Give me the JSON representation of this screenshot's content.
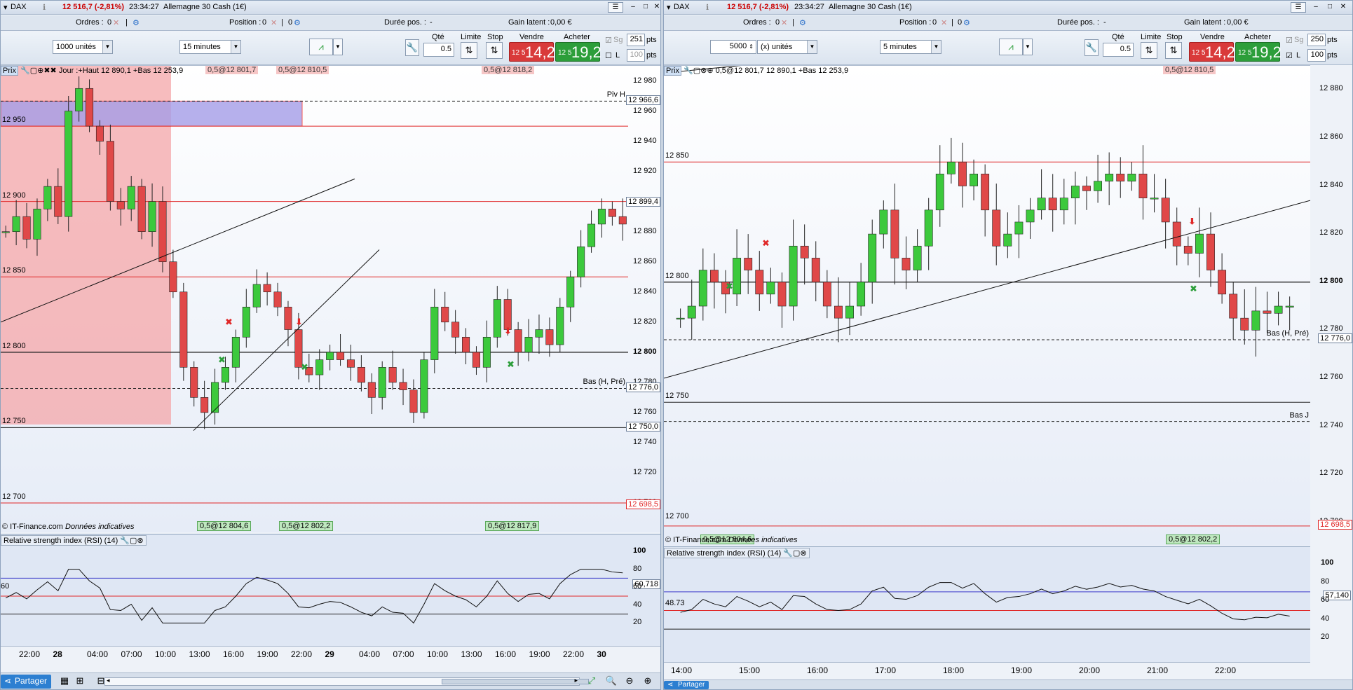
{
  "panels": [
    {
      "titlebar": {
        "instrument": "DAX",
        "price": "12 516,7 (-2,81%)",
        "time": "23:34:27",
        "name": "Allemagne 30 Cash (1€)"
      },
      "status": {
        "ordres_label": "Ordres :",
        "ordres_value": "0",
        "position_label": "Position :",
        "position_value": "0",
        "duree_label": "Durée pos. :",
        "duree_value": "-",
        "gain_label": "Gain latent :",
        "gain_value": "0,00 €"
      },
      "toolbar": {
        "units_value": "1000 unités",
        "timeframe_value": "15 minutes",
        "qte_label": "Qté",
        "qte_value": "0.5",
        "limite_label": "Limite",
        "stop_label": "Stop",
        "vendre_label": "Vendre",
        "acheter_label": "Acheter",
        "sell_small": "12 5",
        "sell_big": "14,2",
        "buy_small": "12 5",
        "buy_big": "19,2",
        "sg_label": "Sg",
        "sg_value": "251",
        "l_label": "L",
        "l_value": "100",
        "pts_label": "pts"
      },
      "legend": {
        "prix_label": "Prix",
        "text": "Jour :+Haut 12 890,1 +Bas 12 253,9"
      },
      "top_tags": [
        "0,5@12 801,7",
        "0,5@12 810,5",
        "0,5@12 818,2"
      ],
      "bottom_tags": [
        "0,5@12 804,6",
        "0,5@12 802,2",
        "0,5@12 817,9"
      ],
      "copyright": "© IT-Finance.com",
      "copyright_note": "Données indicatives",
      "price_axis": [
        "12 980",
        "12 960",
        "12 940",
        "12 920",
        "12 900",
        "12 880",
        "12 860",
        "12 840",
        "12 820",
        "12 800",
        "12 780",
        "12 760",
        "12 740",
        "12 720",
        "12 700"
      ],
      "axis_boxes": {
        "piv_h": "12 966,6",
        "cur": "12 899,4",
        "bas": "12 776,0",
        "low": "12 750,0",
        "red": "12 698,5"
      },
      "line_labels": {
        "l12950": "12 950",
        "l12900": "12 900",
        "l12850": "12 850",
        "l12800": "12 800",
        "l12750": "12 750",
        "l12700": "12 700",
        "piv_h": "Piv H",
        "bas": "Bas (H, Pré)"
      },
      "rsi": {
        "title": "Relative strength index (RSI) (14)",
        "value": "60,718",
        "left_val": "60",
        "ticks": [
          "100",
          "80",
          "60",
          "40",
          "20"
        ]
      },
      "xaxis": [
        "22:00",
        "28",
        "04:00",
        "07:00",
        "10:00",
        "13:00",
        "16:00",
        "19:00",
        "22:00",
        "29",
        "04:00",
        "07:00",
        "10:00",
        "13:00",
        "16:00",
        "19:00",
        "22:00",
        "30"
      ],
      "bottombar": {
        "share_label": "Partager"
      },
      "chart_data": {
        "type": "candlestick",
        "title": "DAX",
        "ylim": [
          12680,
          12990
        ],
        "x": [
          "22:00",
          "28",
          "04:00",
          "07:00",
          "10:00",
          "13:00",
          "16:00",
          "19:00",
          "22:00",
          "29",
          "04:00",
          "07:00",
          "10:00",
          "13:00",
          "16:00",
          "19:00",
          "22:00",
          "30"
        ],
        "close_path": [
          12880,
          12890,
          12875,
          12895,
          12910,
          12890,
          12960,
          12975,
          12950,
          12940,
          12900,
          12895,
          12910,
          12880,
          12900,
          12860,
          12840,
          12790,
          12770,
          12760,
          12780,
          12790,
          12810,
          12830,
          12845,
          12840,
          12830,
          12815,
          12790,
          12785,
          12795,
          12800,
          12795,
          12790,
          12780,
          12770,
          12790,
          12780,
          12775,
          12760,
          12795,
          12830,
          12820,
          12810,
          12800,
          12790,
          12810,
          12835,
          12815,
          12800,
          12810,
          12815,
          12805,
          12830,
          12850,
          12870,
          12885,
          12895,
          12890,
          12885
        ],
        "horizontal_lines": [
          12966.6,
          12950,
          12900,
          12850,
          12800,
          12776,
          12750,
          12700
        ]
      }
    },
    {
      "titlebar": {
        "instrument": "DAX",
        "price": "12 516,7 (-2,81%)",
        "time": "23:34:27",
        "name": "Allemagne 30 Cash (1€)"
      },
      "status": {
        "ordres_label": "Ordres :",
        "ordres_value": "0",
        "position_label": "Position :",
        "position_value": "0",
        "duree_label": "Durée pos. :",
        "duree_value": "-",
        "gain_label": "Gain latent :",
        "gain_value": "0,00 €"
      },
      "toolbar": {
        "units_value": "(x) unités",
        "units_num": "5000",
        "timeframe_value": "5 minutes",
        "qte_label": "Qté",
        "qte_value": "0.5",
        "limite_label": "Limite",
        "stop_label": "Stop",
        "vendre_label": "Vendre",
        "acheter_label": "Acheter",
        "sell_small": "12 5",
        "sell_big": "14,2",
        "buy_small": "12 5",
        "buy_big": "19,2",
        "sg_label": "Sg",
        "sg_value": "250",
        "l_label": "L",
        "l_value": "100",
        "pts_label": "pts"
      },
      "legend": {
        "prix_label": "Prix",
        "text": "0,5@12 801,7 12 890,1 +Bas 12 253,9"
      },
      "top_tags": [
        "0,5@12 810,5"
      ],
      "bottom_tags": [
        "0,5@12 804,6",
        "0,5@12 802,2"
      ],
      "copyright": "© IT-Finance.com",
      "copyright_note": "Données indicatives",
      "price_axis": [
        "12 880",
        "12 860",
        "12 840",
        "12 820",
        "12 800",
        "12 780",
        "12 760",
        "12 740",
        "12 720",
        "12 700"
      ],
      "axis_boxes": {
        "bas": "12 776,0",
        "red": "12 698,5"
      },
      "line_labels": {
        "l12850": "12 850",
        "l12800": "12 800",
        "l12750": "12 750",
        "l12700": "12 700",
        "bas": "Bas (H, Pré)",
        "basj": "Bas J"
      },
      "rsi": {
        "title": "Relative strength index (RSI) (14)",
        "value": "57,140",
        "left_val": "48.73",
        "ticks": [
          "100",
          "80",
          "60",
          "40",
          "20"
        ]
      },
      "xaxis": [
        "14:00",
        "15:00",
        "16:00",
        "17:00",
        "18:00",
        "19:00",
        "20:00",
        "21:00",
        "22:00"
      ],
      "bottombar": {
        "share_label": "Partager"
      },
      "chart_data": {
        "type": "candlestick",
        "title": "DAX",
        "ylim": [
          12690,
          12890
        ],
        "x": [
          "14:00",
          "15:00",
          "16:00",
          "17:00",
          "18:00",
          "19:00",
          "20:00",
          "21:00",
          "22:00"
        ],
        "close_path": [
          12785,
          12790,
          12805,
          12800,
          12795,
          12810,
          12805,
          12795,
          12800,
          12790,
          12815,
          12810,
          12800,
          12790,
          12785,
          12790,
          12800,
          12820,
          12830,
          12810,
          12805,
          12815,
          12830,
          12845,
          12850,
          12840,
          12845,
          12830,
          12815,
          12820,
          12825,
          12830,
          12835,
          12830,
          12835,
          12840,
          12838,
          12842,
          12845,
          12842,
          12845,
          12835,
          12835,
          12825,
          12815,
          12812,
          12820,
          12805,
          12795,
          12785,
          12780,
          12788,
          12787,
          12790,
          12790
        ],
        "horizontal_lines": [
          12850,
          12800,
          12776,
          12750,
          12742,
          12698.5
        ]
      }
    }
  ]
}
